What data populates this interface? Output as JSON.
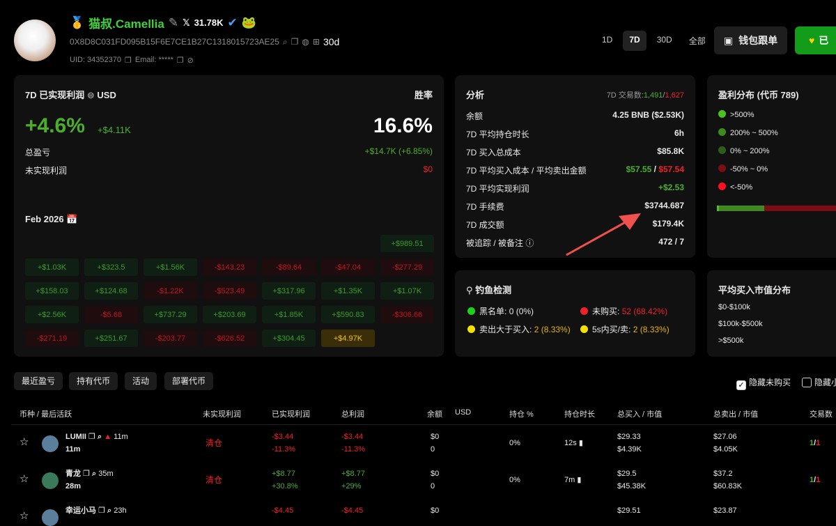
{
  "profile": {
    "name": "猫叔.Camellia",
    "followers": "31.78K",
    "address": "0X8D8C031FD095B15F6E7CE1B27C1318015723AE25",
    "period_tag": "30d",
    "uid": "UID: 34352370",
    "email": "Email: *****"
  },
  "timeframes": [
    "1D",
    "7D",
    "30D",
    "全部"
  ],
  "buttons": {
    "copy_trade": "钱包跟单",
    "follow": "已"
  },
  "pnl": {
    "title": "7D 已实现利润",
    "currency": "USD",
    "winrate_label": "胜率",
    "pct": "+4.6%",
    "amount": "+$4.11K",
    "winrate": "16.6%",
    "total_label": "总盈亏",
    "total_value": "+$14.7K (+6.85%)",
    "unreal_label": "未实现利润",
    "unreal_value": "$0",
    "month": "Feb 2026"
  },
  "calendar": [
    [
      "",
      "",
      "",
      "",
      "",
      "",
      "+$989.51"
    ],
    [
      "+$1.03K",
      "+$323.5",
      "+$1.56K",
      "-$143.23",
      "-$89.64",
      "-$47.04",
      "-$277.29"
    ],
    [
      "+$158.03",
      "+$124.68",
      "-$1.22K",
      "-$523.49",
      "+$317.96",
      "+$1.35K",
      "+$1.07K"
    ],
    [
      "+$2.56K",
      "-$5.68",
      "+$737.29",
      "+$203.69",
      "+$1.85K",
      "+$590.83",
      "-$306.66"
    ],
    [
      "-$271.19",
      "+$251.67",
      "-$203.77",
      "-$626.52",
      "+$304.45",
      "+$4.97K",
      ""
    ]
  ],
  "analysis": {
    "title": "分析",
    "trades_label": "7D 交易数:",
    "buys": "1,491",
    "sells": "1,627",
    "rows": [
      {
        "label": "余额",
        "value": "4.25 BNB ($2.53K)"
      },
      {
        "label": "7D 平均持仓时长",
        "value": "6h"
      },
      {
        "label": "7D 买入总成本",
        "value": "$85.8K"
      },
      {
        "label": "7D 平均买入成本 / 平均卖出金额",
        "v1": "$57.55",
        "v2": "$57.54"
      },
      {
        "label": "7D 平均实现利润",
        "value": "+$2.53"
      },
      {
        "label": "7D 手续费",
        "value": "$3744.687"
      },
      {
        "label": "7D 成交额",
        "value": "$179.4K"
      },
      {
        "label": "被追踪 / 被备注",
        "value": "472 / 7"
      }
    ]
  },
  "distribution": {
    "title": "盈利分布 (代币 789)",
    "items": [
      ">500%",
      "200% ~ 500%",
      "0% ~ 200%",
      "-50% ~ 0%",
      "<-50%"
    ],
    "colors": [
      "#4bc21f",
      "#3f8a1e",
      "#2e5e18",
      "#7a0e14",
      "#ff1020"
    ]
  },
  "phishing": {
    "title": "钓鱼检测",
    "items": [
      {
        "label": "黑名单:",
        "value": "0 (0%)"
      },
      {
        "label": "未购买:",
        "value": "52 (68.42%)"
      },
      {
        "label": "卖出大于买入:",
        "value": "2 (8.33%)"
      },
      {
        "label": "5s内买/卖:",
        "value": "2 (8.33%)"
      }
    ]
  },
  "mcap": {
    "title": "平均买入市值分布",
    "items": [
      "$0-$100k",
      "$100k-$500k",
      ">$500k"
    ]
  },
  "tabs": [
    "最近盈亏",
    "持有代币",
    "活动",
    "部署代币"
  ],
  "filters": [
    "隐藏未购买",
    "隐藏小"
  ],
  "table": {
    "headers": [
      "币种 / 最后活跃",
      "未实现利润",
      "已实现利润",
      "总利润",
      "余额",
      "USD",
      "持仓 %",
      "持仓时长",
      "总买入 / 市值",
      "总卖出 / 市值",
      "交易数"
    ],
    "rows": [
      {
        "token": "LUMII",
        "age": "11m",
        "last": "11m",
        "unreal": "清仓",
        "real": "-$3.44",
        "real_pct": "-11.3%",
        "total": "-$3.44",
        "total_pct": "-11.3%",
        "bal": "$0",
        "bal2": "0",
        "pos": "0%",
        "hold": "12s",
        "buy": "$29.33",
        "buy_mc": "$4.39K",
        "sell": "$27.06",
        "sell_mc": "$4.05K",
        "tb": "1",
        "ts": "1"
      },
      {
        "token": "青龙",
        "age": "35m",
        "last": "28m",
        "unreal": "清仓",
        "real": "+$8.77",
        "real_pct": "+30.8%",
        "total": "+$8.77",
        "total_pct": "+29%",
        "bal": "$0",
        "bal2": "0",
        "pos": "0%",
        "hold": "7m",
        "buy": "$29.5",
        "buy_mc": "$45.38K",
        "sell": "$37.2",
        "sell_mc": "$60.83K",
        "tb": "1",
        "ts": "1"
      },
      {
        "token": "幸运小马",
        "age": "23h",
        "real": "-$4.45",
        "total": "-$4.45",
        "bal": "$0",
        "buy": "$29.51",
        "sell": "$23.87"
      }
    ]
  }
}
